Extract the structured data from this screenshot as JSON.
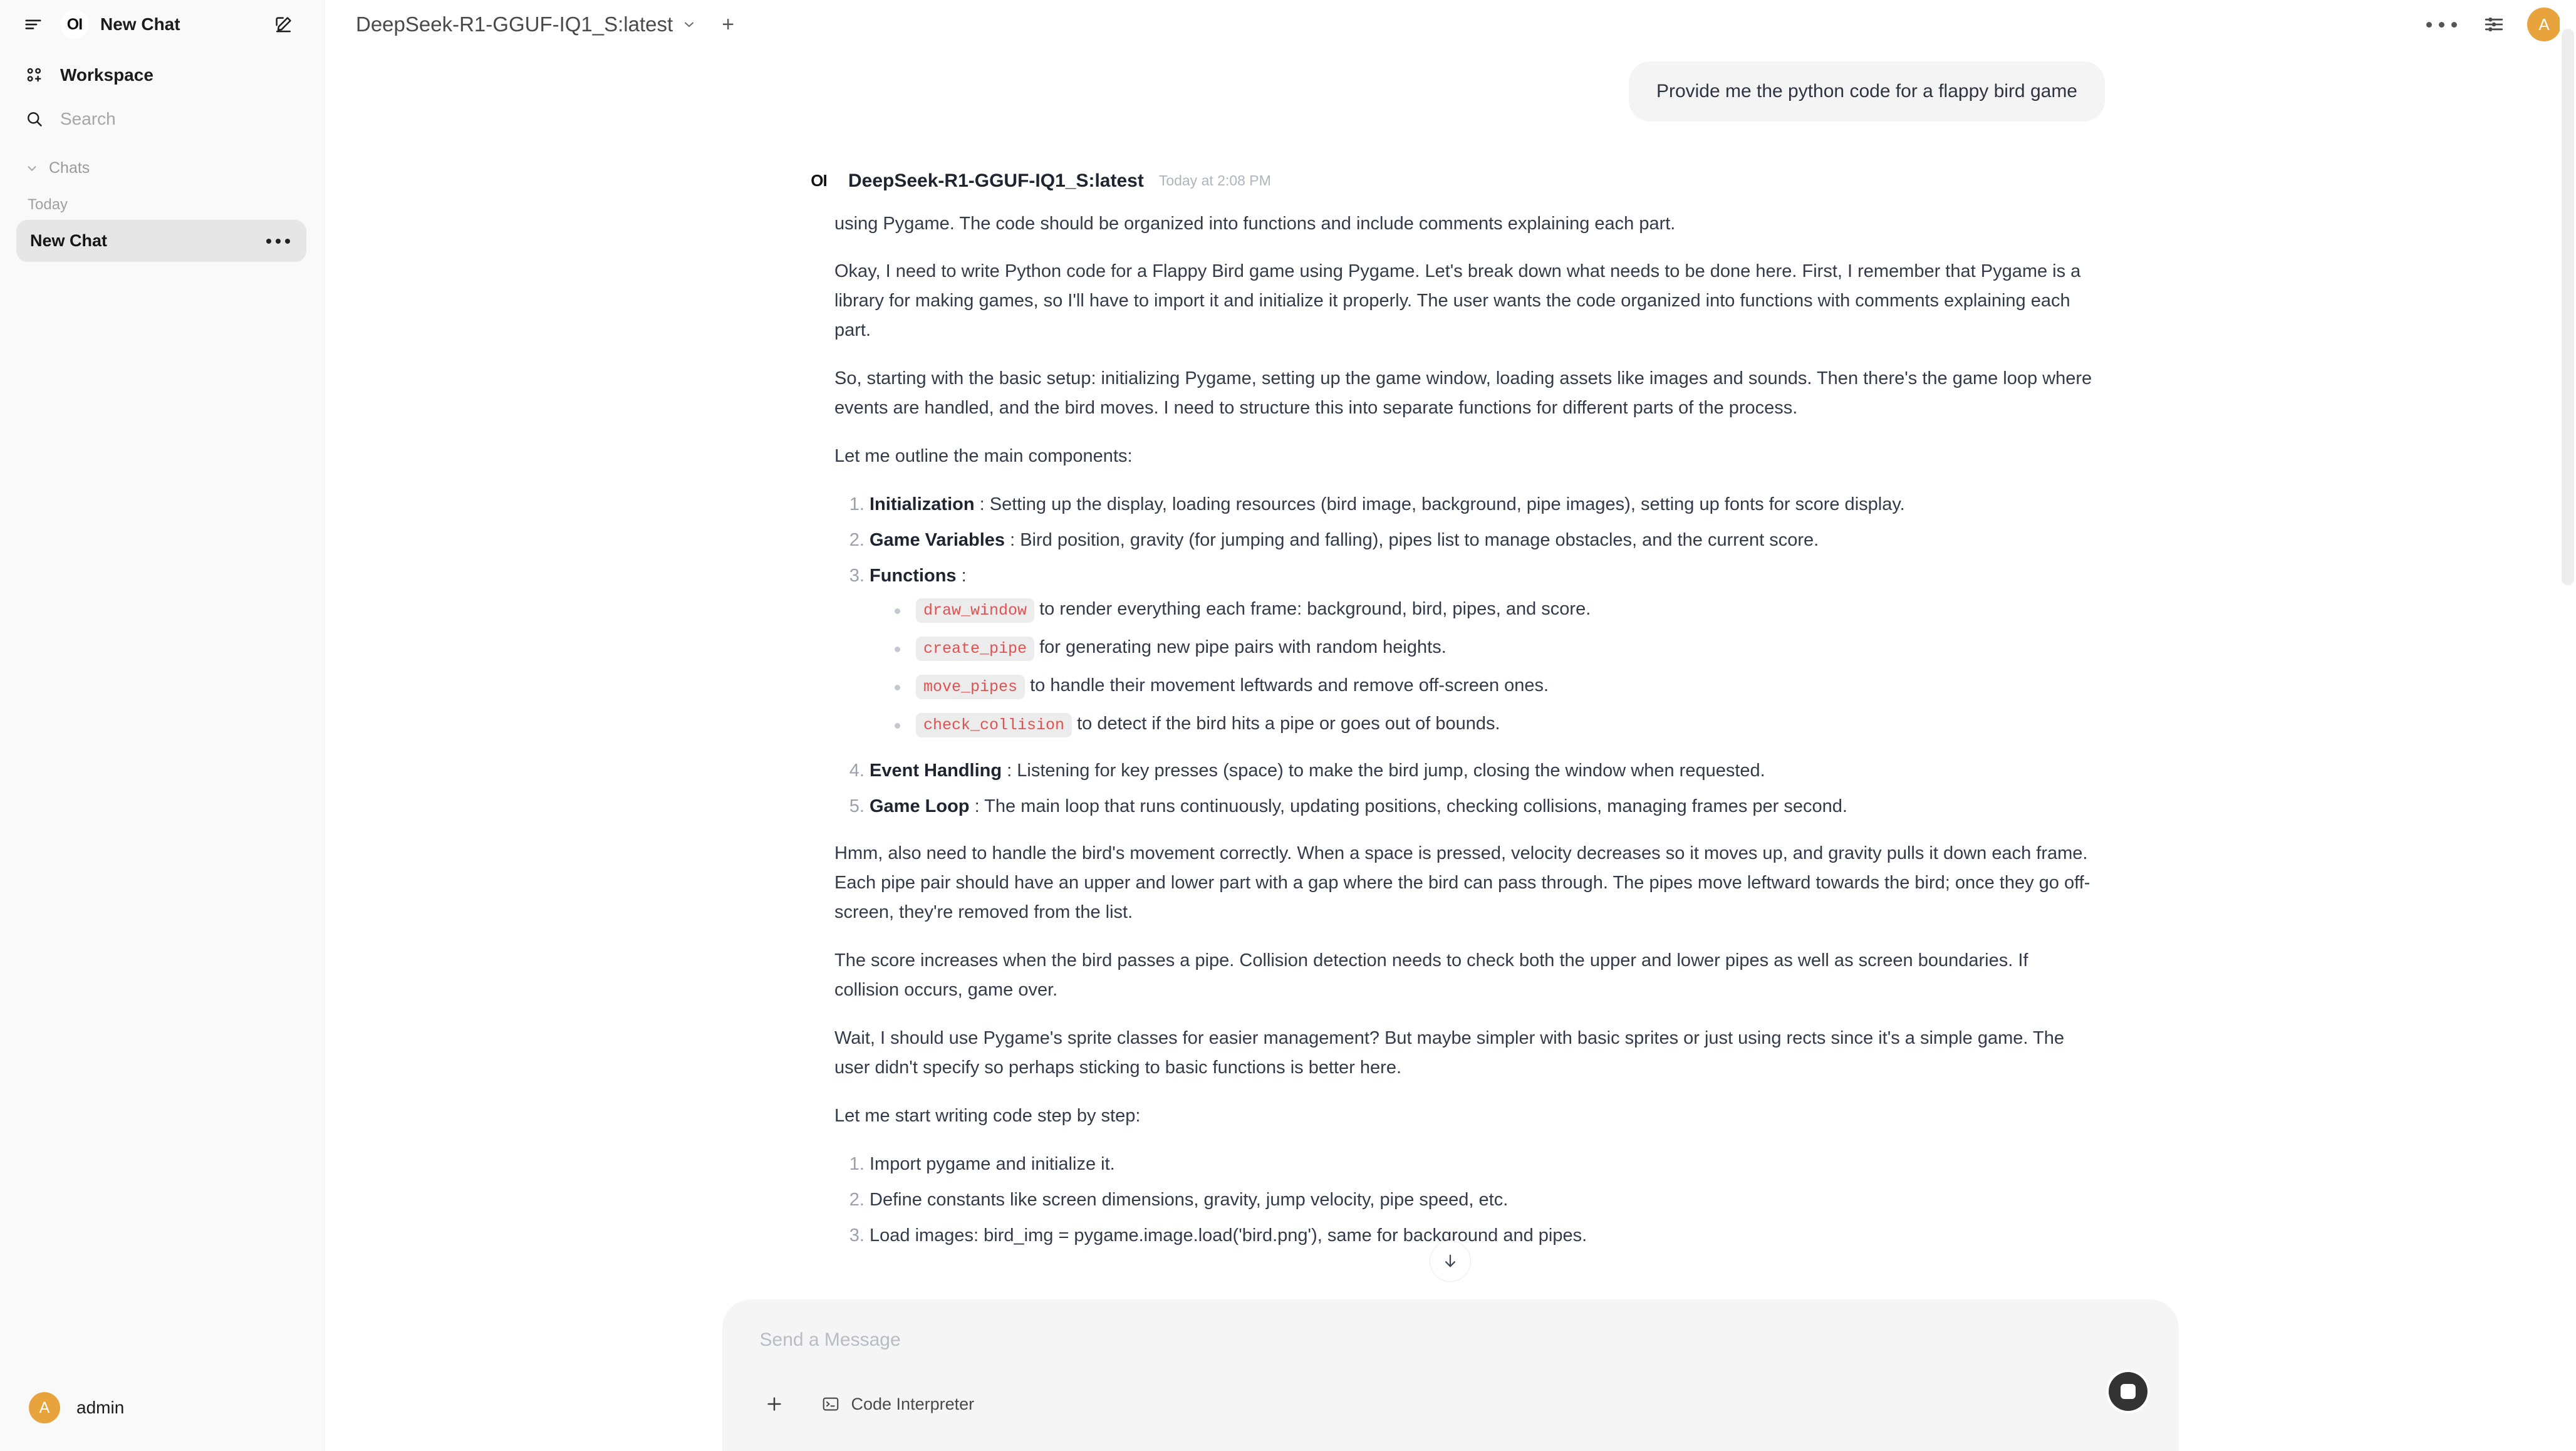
{
  "sidebar": {
    "brand_logo": "OI",
    "brand_title": "New Chat",
    "menu_icon": "hamburger-icon",
    "new_chat_icon": "pencil-square-icon",
    "workspace_label": "Workspace",
    "search_placeholder": "Search",
    "chats_label": "Chats",
    "day_group": "Today",
    "chat_items": [
      {
        "title": "New Chat",
        "active": true
      }
    ],
    "user": {
      "initial": "A",
      "name": "admin"
    }
  },
  "topbar": {
    "model_name": "DeepSeek-R1-GGUF-IQ1_S:latest",
    "chevron_icon": "chevron-down-icon",
    "add_model_label": "+",
    "more_icon": "ellipsis-icon",
    "controls_icon": "sliders-icon",
    "avatar_initial": "A",
    "avatar_color": "#e8a33d"
  },
  "conversation": {
    "user_message": "Provide me the python code for a flappy bird game",
    "assistant": {
      "logo": "OI",
      "name": "DeepSeek-R1-GGUF-IQ1_S:latest",
      "timestamp": "Today at 2:08 PM",
      "p1": "using Pygame. The code should be organized into functions and include comments explaining each part.",
      "p2": "Okay, I need to write Python code for a Flappy Bird game using Pygame. Let's break down what needs to be done here. First, I remember that Pygame is a library for making games, so I'll have to import it and initialize it properly. The user wants the code organized into functions with comments explaining each part.",
      "p3": "So, starting with the basic setup: initializing Pygame, setting up the game window, loading assets like images and sounds. Then there's the game loop where events are handled, and the bird moves. I need to structure this into separate functions for different parts of the process.",
      "p4": "Let me outline the main components:",
      "components": [
        {
          "term": "Initialization",
          "sep": " : ",
          "desc": "Setting up the display, loading resources (bird image, background, pipe images), setting up fonts for score display."
        },
        {
          "term": "Game Variables",
          "sep": " : ",
          "desc": "Bird position, gravity (for jumping and falling), pipes list to manage obstacles, and the current score."
        },
        {
          "term": "Functions",
          "sep": " :",
          "desc": ""
        },
        {
          "term": "Event Handling",
          "sep": " : ",
          "desc": "Listening for key presses (space) to make the bird jump, closing the window when requested."
        },
        {
          "term": "Game Loop",
          "sep": " : ",
          "desc": "The main loop that runs continuously, updating positions, checking collisions, managing frames per second."
        }
      ],
      "functions_list": [
        {
          "code": "draw_window",
          "desc": "to render everything each frame: background, bird, pipes, and score."
        },
        {
          "code": "create_pipe",
          "desc": "for generating new pipe pairs with random heights."
        },
        {
          "code": "move_pipes",
          "desc": "to handle their movement leftwards and remove off-screen ones."
        },
        {
          "code": "check_collision",
          "desc": "to detect if the bird hits a pipe or goes out of bounds."
        }
      ],
      "p5": "Hmm, also need to handle the bird's movement correctly. When a space is pressed, velocity decreases so it moves up, and gravity pulls it down each frame. Each pipe pair should have an upper and lower part with a gap where the bird can pass through. The pipes move leftward towards the bird; once they go off-screen, they're removed from the list.",
      "p6": "The score increases when the bird passes a pipe. Collision detection needs to check both the upper and lower pipes as well as screen boundaries. If collision occurs, game over.",
      "p7": "Wait, I should use Pygame's sprite classes for easier management? But maybe simpler with basic sprites or just using rects since it's a simple game. The user didn't specify so perhaps sticking to basic functions is better here.",
      "p8": "Let me start writing code step by step:",
      "steps": [
        "Import pygame and initialize it.",
        "Define constants like screen dimensions, gravity, jump velocity, pipe speed, etc.",
        "Load images: bird_img = pygame.image.load('bird.png'), same for background and pipes."
      ]
    },
    "scroll_to_bottom_icon": "arrow-down-icon"
  },
  "composer": {
    "placeholder": "Send a Message",
    "add_icon": "plus-icon",
    "tool_label": "Code Interpreter",
    "tool_icon": "terminal-icon",
    "stop_icon": "stop-button-icon"
  },
  "colors": {
    "accent": "#e8a33d",
    "inline_code_text": "#e05252",
    "inline_code_bg": "#ececec",
    "sidebar_bg": "#f9f9f9",
    "active_chat_bg": "#e6e6e6",
    "user_bubble_bg": "#f4f4f5",
    "composer_bg": "#f5f5f5"
  }
}
